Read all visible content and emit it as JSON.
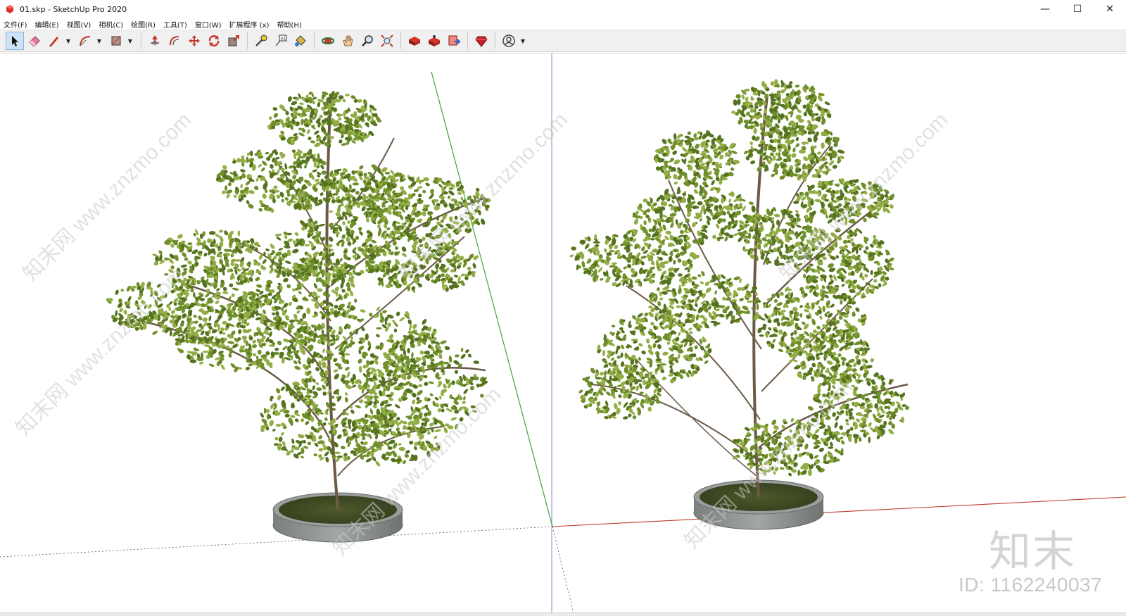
{
  "window": {
    "title": "01.skp - SketchUp Pro 2020",
    "controls": {
      "minimize": "—",
      "maximize": "☐",
      "close": "✕"
    }
  },
  "menu": [
    {
      "label": "文件(F)"
    },
    {
      "label": "编辑(E)"
    },
    {
      "label": "视图(V)"
    },
    {
      "label": "相机(C)"
    },
    {
      "label": "绘图(R)"
    },
    {
      "label": "工具(T)"
    },
    {
      "label": "窗口(W)"
    },
    {
      "label": "扩展程序 (x)"
    },
    {
      "label": "帮助(H)"
    }
  ],
  "toolbar": {
    "tools": [
      {
        "name": "select",
        "icon": "select-arrow-icon",
        "active": true
      },
      {
        "name": "eraser",
        "icon": "eraser-icon"
      },
      {
        "name": "line",
        "icon": "pencil-icon"
      },
      {
        "name": "arc",
        "icon": "arc-icon"
      },
      {
        "name": "rectangle",
        "icon": "rectangle-icon"
      },
      {
        "name": "push-pull",
        "icon": "push-pull-icon"
      },
      {
        "name": "offset",
        "icon": "offset-icon"
      },
      {
        "name": "move",
        "icon": "move-icon"
      },
      {
        "name": "rotate",
        "icon": "rotate-icon"
      },
      {
        "name": "scale",
        "icon": "scale-icon"
      },
      {
        "name": "tape-measure",
        "icon": "tape-measure-icon"
      },
      {
        "name": "text",
        "icon": "text-icon"
      },
      {
        "name": "paint-bucket",
        "icon": "paint-bucket-icon"
      },
      {
        "name": "orbit",
        "icon": "orbit-icon"
      },
      {
        "name": "pan",
        "icon": "pan-hand-icon"
      },
      {
        "name": "zoom",
        "icon": "zoom-icon"
      },
      {
        "name": "zoom-extents",
        "icon": "zoom-extents-icon"
      },
      {
        "name": "3d-warehouse",
        "icon": "warehouse-icon"
      },
      {
        "name": "extension-warehouse",
        "icon": "extension-warehouse-icon"
      },
      {
        "name": "layout",
        "icon": "send-to-layout-icon"
      },
      {
        "name": "extension-manager",
        "icon": "ruby-gem-icon"
      },
      {
        "name": "account",
        "icon": "user-account-icon"
      }
    ]
  },
  "watermark": {
    "logo": "知末",
    "id_text": "ID: 1162240037",
    "diagonal_text": "知末网 www.znzmo.com"
  },
  "colors": {
    "axis_green": "#3aa63a",
    "axis_red": "#c0392b",
    "axis_blue": "#3b4bd0",
    "foliage": "#6f8f2a",
    "trunk": "#6b5a48",
    "planter": "#8f9290"
  }
}
